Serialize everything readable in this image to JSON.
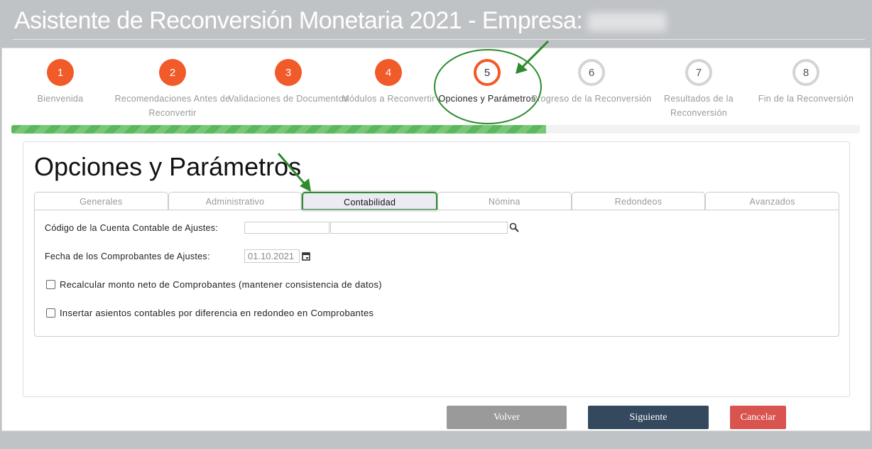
{
  "header": {
    "title": "Asistente de Reconversión Monetaria 2021 - Empresa:"
  },
  "steps": [
    {
      "number": "1",
      "label": "Bienvenida",
      "state": "done"
    },
    {
      "number": "2",
      "label": "Recomendaciones Antes de Reconvertir",
      "state": "done"
    },
    {
      "number": "3",
      "label": "Validaciones de Documentos",
      "state": "done"
    },
    {
      "number": "4",
      "label": "Módulos a Reconvertir",
      "state": "done"
    },
    {
      "number": "5",
      "label": "Opciones y Parámetros",
      "state": "current"
    },
    {
      "number": "6",
      "label": "Progreso de la Reconversión",
      "state": "todo"
    },
    {
      "number": "7",
      "label": "Resultados de la Reconversión",
      "state": "todo"
    },
    {
      "number": "8",
      "label": "Fin de la Reconversión",
      "state": "todo"
    }
  ],
  "progress_percent": 63,
  "page_title": "Opciones y Parámetros",
  "tabs": [
    "Generales",
    "Administrativo",
    "Contabilidad",
    "Nómina",
    "Redondeos",
    "Avanzados"
  ],
  "active_tab": "Contabilidad",
  "form": {
    "account_label": "Código de la Cuenta Contable de Ajustes:",
    "account_code": "",
    "account_name": "",
    "date_label": "Fecha de los Comprobantes de Ajustes:",
    "date_value": "01.10.2021",
    "recalc_label": "Recalcular monto neto de Comprobantes (mantener consistencia de datos)",
    "recalc_checked": false,
    "insert_label": "Insertar asientos contables por diferencia en redondeo en Comprobantes",
    "insert_checked": false
  },
  "buttons": {
    "back": "Volver",
    "next": "Siguiente",
    "cancel": "Cancelar"
  },
  "colors": {
    "done": "#f15a29",
    "back": "#9a9a9a",
    "next": "#34495e",
    "cancel": "#d9534f",
    "annotation": "#2e8b2e"
  }
}
